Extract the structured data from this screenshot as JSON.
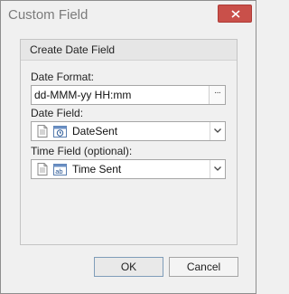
{
  "window": {
    "title": "Custom Field"
  },
  "group": {
    "title": "Create Date Field"
  },
  "date_format": {
    "label": "Date Format:",
    "value": "dd-MMM-yy HH:mm",
    "browse_label": "···"
  },
  "date_field": {
    "label": "Date Field:",
    "value": "DateSent",
    "icon": "calendar-field-icon"
  },
  "time_field": {
    "label": "Time Field (optional):",
    "value": "Time Sent",
    "icon": "text-field-icon",
    "icon_text": "ab"
  },
  "buttons": {
    "ok": "OK",
    "cancel": "Cancel"
  },
  "colors": {
    "close_button": "#c9504a",
    "title_text": "#7b7b7b"
  }
}
